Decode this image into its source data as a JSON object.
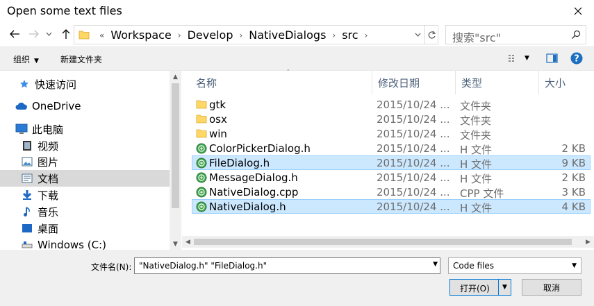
{
  "window": {
    "title": "Open some text files"
  },
  "nav": {
    "breadcrumbs": [
      "Workspace",
      "Develop",
      "NativeDialogs",
      "src"
    ],
    "overflow_marker": "«",
    "search_placeholder": "搜索\"src\""
  },
  "toolbar": {
    "organize_label": "组织",
    "new_folder_label": "新建文件夹"
  },
  "sidebar": {
    "items": [
      {
        "label": "快速访问",
        "icon": "star-icon"
      },
      {
        "label": "OneDrive",
        "icon": "cloud-icon"
      },
      {
        "label": "此电脑",
        "icon": "computer-icon"
      },
      {
        "label": "视频",
        "icon": "video-icon"
      },
      {
        "label": "图片",
        "icon": "picture-icon"
      },
      {
        "label": "文档",
        "icon": "document-icon",
        "selected": true
      },
      {
        "label": "下载",
        "icon": "download-icon"
      },
      {
        "label": "音乐",
        "icon": "music-icon"
      },
      {
        "label": "桌面",
        "icon": "desktop-icon"
      },
      {
        "label": "Windows (C:)",
        "icon": "drive-icon"
      }
    ]
  },
  "columns": {
    "name": "名称",
    "date": "修改日期",
    "type": "类型",
    "size": "大小"
  },
  "files": [
    {
      "name": "gtk",
      "date": "2015/10/24 ...",
      "type": "文件夹",
      "size": "",
      "kind": "folder",
      "selected": false
    },
    {
      "name": "osx",
      "date": "2015/10/24 ...",
      "type": "文件夹",
      "size": "",
      "kind": "folder",
      "selected": false
    },
    {
      "name": "win",
      "date": "2015/10/24 ...",
      "type": "文件夹",
      "size": "",
      "kind": "folder",
      "selected": false
    },
    {
      "name": "ColorPickerDialog.h",
      "date": "2015/10/24 ...",
      "type": "H 文件",
      "size": "2 KB",
      "kind": "file",
      "selected": false
    },
    {
      "name": "FileDialog.h",
      "date": "2015/10/24 ...",
      "type": "H 文件",
      "size": "9 KB",
      "kind": "file",
      "selected": true
    },
    {
      "name": "MessageDialog.h",
      "date": "2015/10/24 ...",
      "type": "H 文件",
      "size": "2 KB",
      "kind": "file",
      "selected": false
    },
    {
      "name": "NativeDialog.cpp",
      "date": "2015/10/24 ...",
      "type": "CPP 文件",
      "size": "3 KB",
      "kind": "file",
      "selected": false
    },
    {
      "name": "NativeDialog.h",
      "date": "2015/10/24 ...",
      "type": "H 文件",
      "size": "4 KB",
      "kind": "file",
      "selected": true
    }
  ],
  "footer": {
    "filename_label": "文件名(N):",
    "filename_value": "\"NativeDialog.h\" \"FileDialog.h\"",
    "filter_value": "Code files",
    "open_label": "打开(O)",
    "cancel_label": "取消"
  },
  "colors": {
    "selection": "#cce8ff",
    "selection_border": "#99d1ff",
    "accent": "#0078d7",
    "folder": "#ffd766",
    "file_icon": "#3fa34d"
  }
}
